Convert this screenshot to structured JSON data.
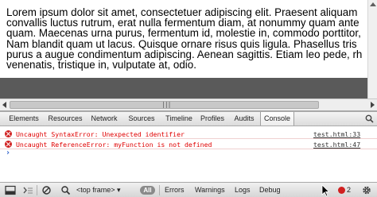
{
  "page": {
    "lines": [
      "Lorem ipsum dolor sit amet, consectetuer adipiscing elit. Praesent aliquam",
      "convallis luctus rutrum, erat nulla fermentum diam, at nonummy quam ante",
      "quam. Maecenas urna purus, fermentum id, molestie in, commodo porttitor,",
      "Nam blandit quam ut lacus. Quisque ornare risus quis ligula. Phasellus tris",
      "purus a augue condimentum adipiscing. Aenean sagittis. Etiam leo pede, rh",
      "venenatis, tristique in, vulputate at, odio."
    ]
  },
  "scrollbar": {
    "grip": "|||"
  },
  "tabs": [
    {
      "label": "Elements"
    },
    {
      "label": "Resources"
    },
    {
      "label": "Network"
    },
    {
      "label": "Sources"
    },
    {
      "label": "Timeline"
    },
    {
      "label": "Profiles"
    },
    {
      "label": "Audits"
    },
    {
      "label": "Console",
      "active": true
    }
  ],
  "console": {
    "messages": [
      {
        "text": "Uncaught SyntaxError: Unexpected identifier",
        "source": "test.html:33",
        "level": "error"
      },
      {
        "text": "Uncaught ReferenceError: myFunction is not defined",
        "source": "test.html:47",
        "level": "error"
      }
    ],
    "prompt": "›"
  },
  "statusbar": {
    "frame": "<top frame>",
    "frame_arrow": "▾",
    "all": "All",
    "filters": [
      "Errors",
      "Warnings",
      "Logs",
      "Debug"
    ],
    "error_count": "2"
  },
  "colors": {
    "error": "#e00000",
    "page_gray": "#5a5a5a"
  },
  "icons": [
    "dock-icon",
    "console-drawer-icon",
    "clear-console-icon",
    "search-icon",
    "error-icon",
    "settings-gear-icon",
    "mouse-cursor-icon"
  ]
}
